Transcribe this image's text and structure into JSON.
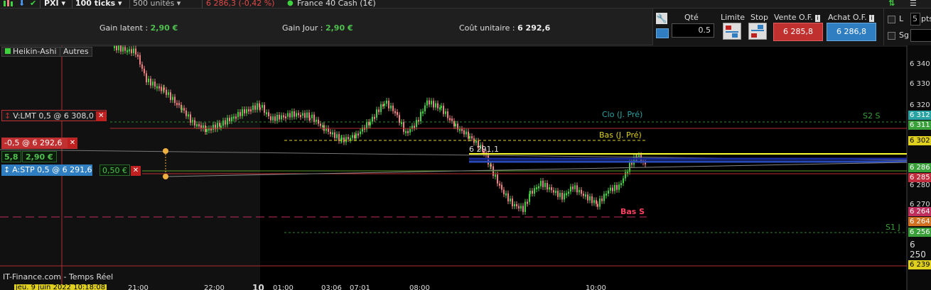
{
  "toolbar": {
    "symbol": "PXI",
    "ticks": "100 ticks",
    "units": "500 unités",
    "price_change": "6 286,3 (-0,42 %)",
    "instrument": "France 40 Cash (1€)"
  },
  "info": {
    "gain_latent_label": "Gain latent :",
    "gain_latent_value": "2,90 €",
    "gain_jour_label": "Gain Jour :",
    "gain_jour_value": "2,90 €",
    "cout_label": "Coût unitaire :",
    "cout_value": "6 292,6"
  },
  "order": {
    "qty_label": "Qté",
    "qty_value": "0.5",
    "limit_label": "Limite",
    "stop_label": "Stop",
    "sell_label": "Vente O.F.",
    "sell_price": "6 285,8",
    "buy_label": "Achat O.F.",
    "buy_price": "6 286,8",
    "opt_l": "L",
    "opt_sg": "Sg",
    "pts_value": "5",
    "pts_label": "pts"
  },
  "chart": {
    "style": "Heikin-Ashi",
    "others": "Autres",
    "watermark": "IT-Finance.com - Temps Réel",
    "date_label": "jeu. 9 juin 2022 10:18:08",
    "x_ticks": [
      "21:00",
      "22:00",
      "10",
      "01:00",
      "03:06",
      "07:01",
      "08:00",
      "10:00"
    ],
    "y_ticks": [
      "6 340",
      "6 330",
      "6 320",
      "6 280",
      "6 270",
      "6 250"
    ],
    "price_tags": [
      {
        "text": "6 312",
        "color": "#29a3a3"
      },
      {
        "text": "6 311",
        "color": "#3aa03a"
      },
      {
        "text": "6 302",
        "color": "#e0d020"
      },
      {
        "text": "6 286",
        "color": "#3aa03a"
      },
      {
        "text": "6 285",
        "color": "#c02e3e"
      },
      {
        "text": "6 264",
        "color": "#c02e5e"
      },
      {
        "text": "6 264",
        "color": "#d07020"
      },
      {
        "text": "6 256",
        "color": "#3aa03a"
      },
      {
        "text": "6 239",
        "color": "#e0d020"
      }
    ],
    "levels": {
      "clo": "Clo (J. Pré)",
      "bas": "Bas (J. Pré)",
      "s2": "S2 S",
      "s1": "S1 J",
      "bas_s": "Bas S",
      "mark": "6 291,1"
    },
    "orders": {
      "limit": "V:LMT 0,5 @ 6 308,0",
      "position": "-0,5 @ 6 292,6",
      "pos_qty": "5,8",
      "pos_gain": "2,90 €",
      "stop": "A:STP 0,5 @ 6 291,6",
      "stop_gain": "0,50 €"
    }
  },
  "colors": {
    "accent_green": "#4fc04f",
    "sell_red": "#c0302e",
    "buy_blue": "#2f7ec2",
    "candle_up": "#3fd23f",
    "candle_down": "#f08080"
  }
}
